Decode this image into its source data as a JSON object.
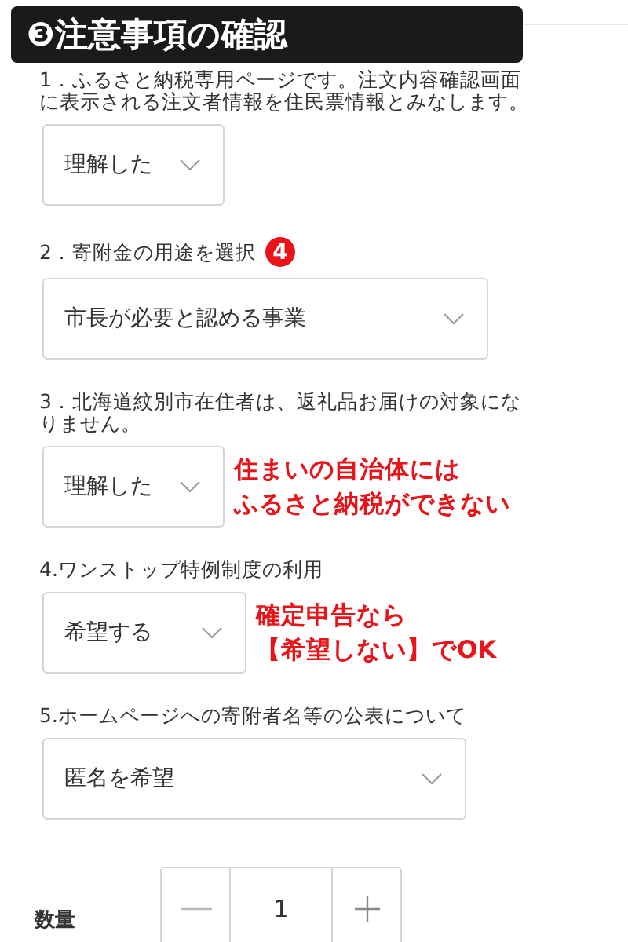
{
  "header": {
    "title": "❸注意事項の確認"
  },
  "questions": [
    {
      "label": "1．ふるさと納税専用ページです。注文内容確認画面に表示される注文者情報を住民票情報とみなします。",
      "value": "理解した"
    },
    {
      "label": "2．寄附金の用途を選択",
      "badge": "4",
      "value": "市長が必要と認める事業"
    },
    {
      "label": "3．北海道紋別市在住者は、返礼品お届けの対象になりません。",
      "value": "理解した",
      "note": [
        "住まいの自治体には",
        "ふるさと納税ができない"
      ]
    },
    {
      "label": "4.ワンストップ特例制度の利用",
      "value": "希望する",
      "note": [
        "確定申告なら",
        "【希望しない】でOK"
      ]
    },
    {
      "label": "5.ホームページへの寄附者名等の公表について",
      "value": "匿名を希望"
    }
  ],
  "quantity": {
    "label": "数量",
    "value": "1"
  }
}
